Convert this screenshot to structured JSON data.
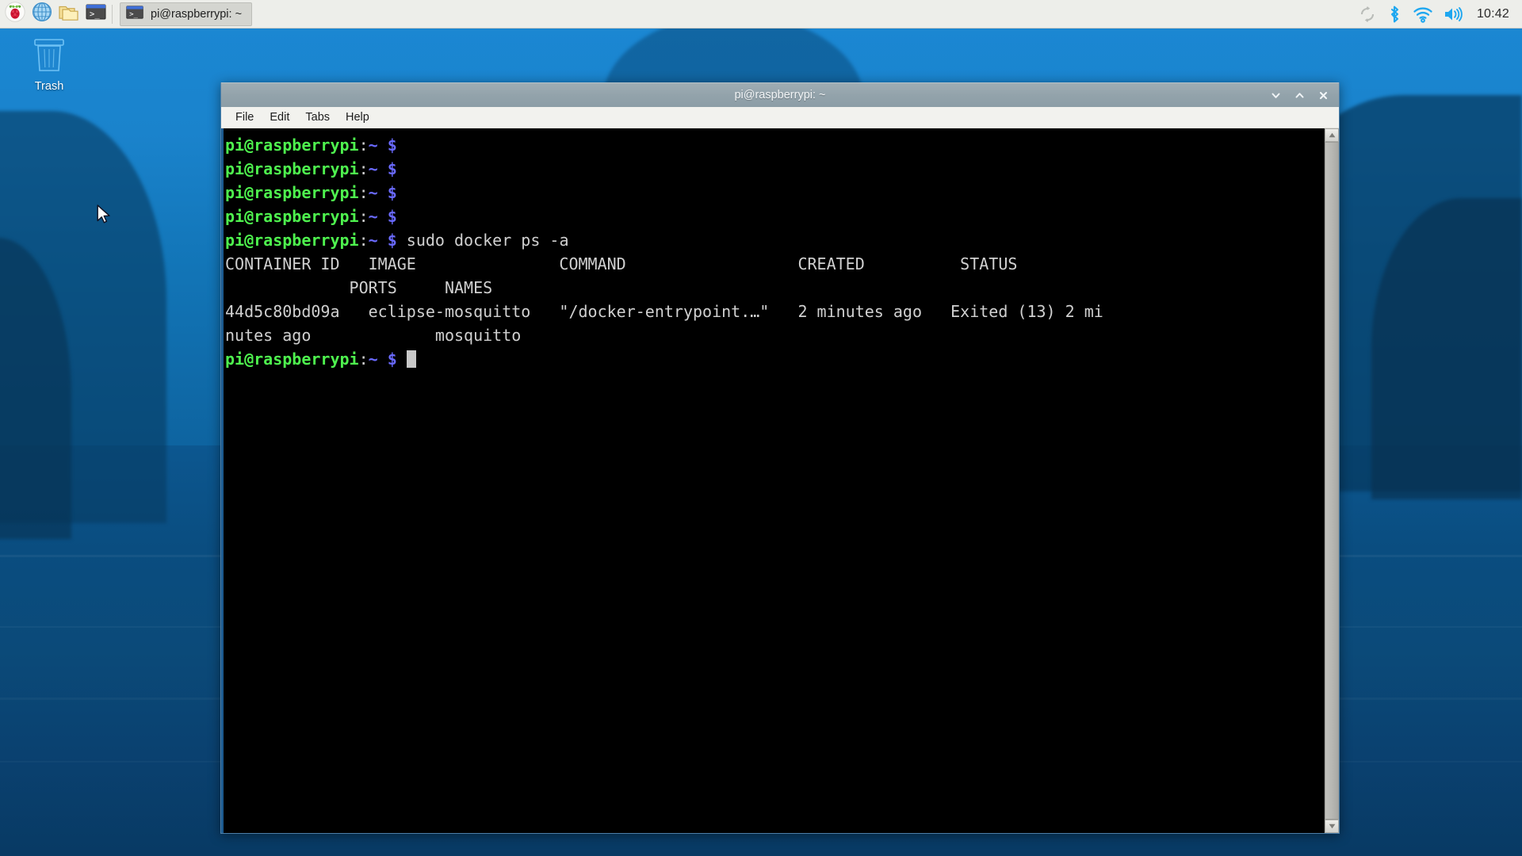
{
  "desktop": {
    "icons": [
      {
        "name": "trash",
        "label": "Trash"
      }
    ]
  },
  "taskbar": {
    "launchers": [
      {
        "name": "raspberry-menu",
        "icon": "raspberry-icon",
        "title": "Menu"
      },
      {
        "name": "web-browser",
        "icon": "globe-icon",
        "title": "Web Browser"
      },
      {
        "name": "file-manager",
        "icon": "folder-icon",
        "title": "File Manager"
      },
      {
        "name": "terminal",
        "icon": "terminal-icon",
        "title": "Terminal"
      }
    ],
    "windows": [
      {
        "name": "terminal-task",
        "icon": "terminal-icon",
        "label": "pi@raspberrypi: ~"
      }
    ],
    "tray": [
      {
        "name": "ejecter",
        "icon": "eject-icon"
      },
      {
        "name": "bluetooth",
        "icon": "bluetooth-icon"
      },
      {
        "name": "wifi",
        "icon": "wifi-icon"
      },
      {
        "name": "volume",
        "icon": "speaker-icon"
      }
    ],
    "clock": "10:42"
  },
  "terminal": {
    "title": "pi@raspberrypi: ~",
    "window_controls": {
      "minimize": "ˇ",
      "maximize": "ˆ",
      "close": "✕"
    },
    "menu": [
      {
        "name": "file",
        "label": "File"
      },
      {
        "name": "edit",
        "label": "Edit"
      },
      {
        "name": "tabs",
        "label": "Tabs"
      },
      {
        "name": "help",
        "label": "Help"
      }
    ],
    "prompt": {
      "user": "pi@raspberrypi",
      "colon": ":",
      "path": "~",
      "dollar": "$"
    },
    "lines": [
      {
        "type": "prompt",
        "command": ""
      },
      {
        "type": "prompt",
        "command": ""
      },
      {
        "type": "prompt",
        "command": ""
      },
      {
        "type": "prompt",
        "command": ""
      },
      {
        "type": "prompt",
        "command": " sudo docker ps -a"
      },
      {
        "type": "output",
        "text": "CONTAINER ID   IMAGE               COMMAND                  CREATED          STATUS"
      },
      {
        "type": "output",
        "text": "             PORTS     NAMES"
      },
      {
        "type": "output",
        "text": "44d5c80bd09a   eclipse-mosquitto   \"/docker-entrypoint.…\"   2 minutes ago   Exited (13) 2 mi"
      },
      {
        "type": "output",
        "text": "nutes ago             mosquitto"
      },
      {
        "type": "prompt-cursor",
        "command": " "
      }
    ],
    "docker_ps": {
      "headers": [
        "CONTAINER ID",
        "IMAGE",
        "COMMAND",
        "CREATED",
        "STATUS",
        "PORTS",
        "NAMES"
      ],
      "rows": [
        {
          "container_id": "44d5c80bd09a",
          "image": "eclipse-mosquitto",
          "command": "\"/docker-entrypoint.…\"",
          "created": "2 minutes ago",
          "status": "Exited (13) 2 minutes ago",
          "ports": "",
          "names": "mosquitto"
        }
      ]
    },
    "colors": {
      "background": "#000000",
      "foreground": "#d0d0d0",
      "user_green": "#4ef24e",
      "path_blue": "#6a6aff",
      "cursor": "#c8c8c8"
    }
  },
  "theme": {
    "taskbar_bg": "#edeeea",
    "titlebar_bg": "#93a3ab",
    "accent_blue": "#1c5a8f",
    "tray_icon_blue": "#22a7f0"
  }
}
